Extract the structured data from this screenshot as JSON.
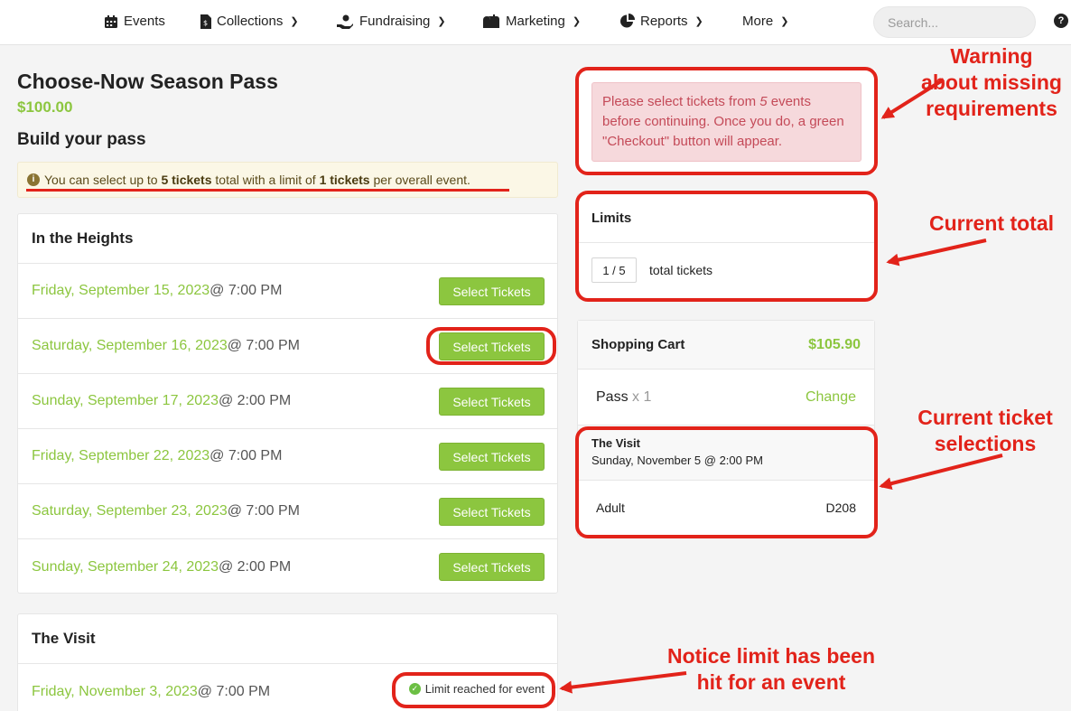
{
  "nav": {
    "items": [
      {
        "label": "Events",
        "icon": "calendar-icon",
        "dropdown": false
      },
      {
        "label": "Collections",
        "icon": "document-icon",
        "dropdown": true
      },
      {
        "label": "Fundraising",
        "icon": "donate-hand-icon",
        "dropdown": true
      },
      {
        "label": "Marketing",
        "icon": "mailbox-icon",
        "dropdown": true
      },
      {
        "label": "Reports",
        "icon": "pie-chart-icon",
        "dropdown": true
      },
      {
        "label": "More",
        "icon": "",
        "dropdown": true
      }
    ],
    "search_placeholder": "Search...",
    "help_glyph": "?"
  },
  "pass": {
    "title": "Choose-Now Season Pass",
    "price": "$100.00",
    "subtitle": "Build your pass"
  },
  "info": {
    "t1": "You can select up to ",
    "b1": "5 tickets",
    "t2": " total with a limit of ",
    "b2": "1 tickets",
    "t3": " per overall event."
  },
  "events": [
    {
      "name": "In the Heights",
      "dates": [
        {
          "date": "Friday, September 15, 2023",
          "time": " @ 7:00 PM",
          "action": "Select Tickets"
        },
        {
          "date": "Saturday, September 16, 2023",
          "time": " @ 7:00 PM",
          "action": "Select Tickets"
        },
        {
          "date": "Sunday, September 17, 2023",
          "time": " @ 2:00 PM",
          "action": "Select Tickets"
        },
        {
          "date": "Friday, September 22, 2023",
          "time": " @ 7:00 PM",
          "action": "Select Tickets"
        },
        {
          "date": "Saturday, September 23, 2023",
          "time": " @ 7:00 PM",
          "action": "Select Tickets"
        },
        {
          "date": "Sunday, September 24, 2023",
          "time": " @ 2:00 PM",
          "action": "Select Tickets"
        }
      ]
    },
    {
      "name": "The Visit",
      "dates": [
        {
          "date": "Friday, November 3, 2023",
          "time": " @ 7:00 PM",
          "status": "Limit reached for event"
        }
      ]
    }
  ],
  "warning": {
    "t1": "Please select tickets from ",
    "count": "5",
    "t2": " events before continuing. Once you do, a green \"Checkout\" button will appear."
  },
  "limits": {
    "title": "Limits",
    "count": "1 / 5",
    "label": "total tickets"
  },
  "cart": {
    "title": "Shopping Cart",
    "total": "$105.90",
    "pass_label": "Pass",
    "pass_qty": " x 1",
    "change_label": "Change",
    "event_name": "The Visit",
    "event_date": "Sunday, November 5 @ 2:00 PM",
    "ticket_type": "Adult",
    "seat": "D208"
  },
  "annotations": {
    "warning": "Warning about missing requirements",
    "total": "Current total",
    "selections": "Current ticket selections",
    "limit": "Notice limit has been hit for an event"
  },
  "colors": {
    "accent_green": "#8cc63f",
    "annotation_red": "#e2231a",
    "warning_bg": "#f6d9dc",
    "warning_text": "#c44a58"
  }
}
